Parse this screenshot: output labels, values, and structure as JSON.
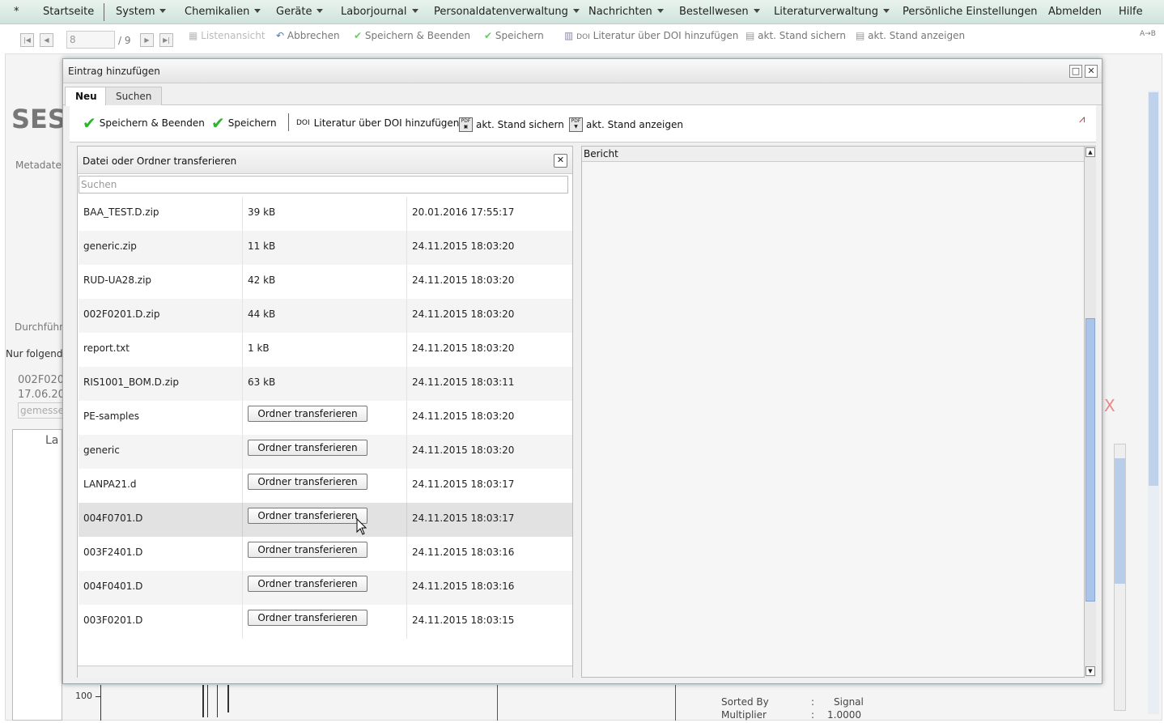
{
  "menu": {
    "star": "*",
    "items": [
      "Startseite",
      "System",
      "Chemikalien",
      "Geräte",
      "Laborjournal",
      "Personaldatenverwaltung",
      "Nachrichten",
      "Bestellwesen",
      "Literaturverwaltung",
      "Persönliche Einstellungen",
      "Abmelden",
      "Hilfe"
    ]
  },
  "bg_toolbar": {
    "page_value": "8",
    "page_total": "/ 9",
    "list_view": "Listenansicht",
    "cancel": "Abbrechen",
    "save_close": "Speichern & Beenden",
    "save": "Speichern",
    "doi_prefix": "DOI",
    "doi_add": "Literatur über DOI hinzufügen",
    "snapshot_save": "akt. Stand sichern",
    "snapshot_show": "akt. Stand anzeigen"
  },
  "bg_page": {
    "title_fragment": "SES",
    "metadata": "Metadaten",
    "durchfuehrung": "Durchführ",
    "nur_folgende": "Nur folgend",
    "sample_line1": "002F020",
    "sample_line2": "17.06.20",
    "gemessen": "gemesse",
    "axis_label": "La",
    "tick_100": "100",
    "sorted_by_label": "Sorted By",
    "sorted_by_value": "Signal",
    "multiplier_label": "Multiplier",
    "multiplier_value": "1.0000",
    "colon": ":"
  },
  "dialog": {
    "title": "Eintrag hinzufügen",
    "tabs": [
      "Neu",
      "Suchen"
    ],
    "toolbar": {
      "save_close": "Speichern & Beenden",
      "save": "Speichern",
      "doi_prefix": "DOI",
      "doi_add": "Literatur über DOI hinzufügen",
      "snapshot_save": "akt. Stand sichern",
      "snapshot_show": "akt. Stand anzeigen"
    }
  },
  "file_panel": {
    "title": "Datei oder Ordner transferieren",
    "search_placeholder": "Suchen",
    "folder_button": "Ordner transferieren",
    "rows": [
      {
        "name": "BAA_TEST.D.zip",
        "size": "39 kB",
        "date": "20.01.2016 17:55:17"
      },
      {
        "name": "generic.zip",
        "size": "11 kB",
        "date": "24.11.2015 18:03:20"
      },
      {
        "name": "RUD-UA28.zip",
        "size": "42 kB",
        "date": "24.11.2015 18:03:20"
      },
      {
        "name": "002F0201.D.zip",
        "size": "44 kB",
        "date": "24.11.2015 18:03:20"
      },
      {
        "name": "report.txt",
        "size": "1 kB",
        "date": "24.11.2015 18:03:20"
      },
      {
        "name": "RIS1001_BOM.D.zip",
        "size": "63 kB",
        "date": "24.11.2015 18:03:11"
      },
      {
        "name": "PE-samples",
        "size": "",
        "date": "24.11.2015 18:03:20"
      },
      {
        "name": "generic",
        "size": "",
        "date": "24.11.2015 18:03:20"
      },
      {
        "name": "LANPA21.d",
        "size": "",
        "date": "24.11.2015 18:03:17"
      },
      {
        "name": "004F0701.D",
        "size": "",
        "date": "24.11.2015 18:03:17"
      },
      {
        "name": "003F2401.D",
        "size": "",
        "date": "24.11.2015 18:03:16"
      },
      {
        "name": "004F0401.D",
        "size": "",
        "date": "24.11.2015 18:03:16"
      },
      {
        "name": "003F0201.D",
        "size": "",
        "date": "24.11.2015 18:03:15"
      }
    ]
  },
  "report_panel": {
    "title": "Bericht"
  },
  "colors": {
    "menubar": "#d8ebe4",
    "check_green": "#2ab52a",
    "scroll_thumb": "#a9c5e9"
  }
}
